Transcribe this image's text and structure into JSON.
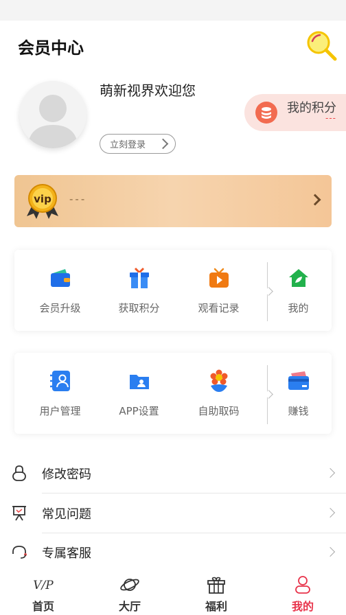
{
  "header": {
    "title": "会员中心",
    "search_icon": "search-icon"
  },
  "profile": {
    "welcome": "萌新视界欢迎您",
    "login_label": "立刻登录",
    "avatar_icon": "avatar-placeholder"
  },
  "points": {
    "label": "我的积分",
    "value": "---"
  },
  "vip": {
    "badge": "vip",
    "text": "---"
  },
  "grid1": {
    "items": [
      {
        "label": "会员升级",
        "icon": "wallet-icon"
      },
      {
        "label": "获取积分",
        "icon": "gift-icon"
      },
      {
        "label": "观看记录",
        "icon": "tv-icon"
      },
      {
        "label": "我的",
        "icon": "home-icon"
      }
    ]
  },
  "grid2": {
    "items": [
      {
        "label": "用户管理",
        "icon": "contacts-icon"
      },
      {
        "label": "APP设置",
        "icon": "folder-icon"
      },
      {
        "label": "自助取码",
        "icon": "flower-icon"
      },
      {
        "label": "赚钱",
        "icon": "card-icon"
      }
    ]
  },
  "menu": {
    "items": [
      {
        "label": "修改密码",
        "icon": "lock-icon"
      },
      {
        "label": "常见问题",
        "icon": "board-icon"
      },
      {
        "label": "专属客服",
        "icon": "headset-icon"
      }
    ]
  },
  "tabbar": {
    "tabs": [
      {
        "label": "首页",
        "icon": "vip-logo-icon"
      },
      {
        "label": "大厅",
        "icon": "planet-icon"
      },
      {
        "label": "福利",
        "icon": "gift-box-icon"
      },
      {
        "label": "我的",
        "icon": "person-icon",
        "active": true
      }
    ]
  },
  "colors": {
    "accent": "#e8334a",
    "vip_gold": "#f0c592",
    "points_bg": "#fbe3df"
  }
}
